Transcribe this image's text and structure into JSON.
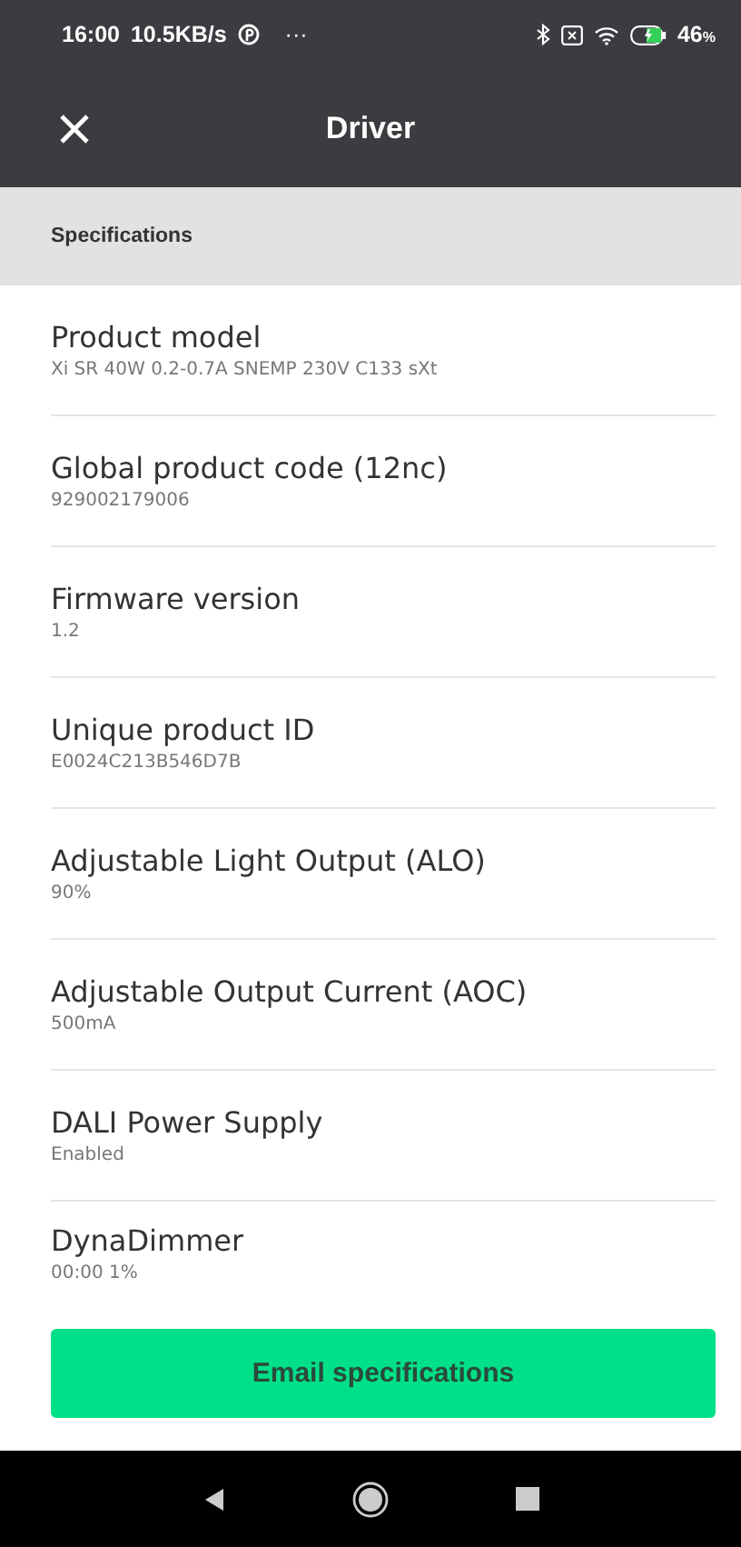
{
  "status_bar": {
    "time": "16:00",
    "speed": "10.5KB/s",
    "more": "···",
    "battery": "46",
    "battery_unit": "%"
  },
  "header": {
    "title": "Driver"
  },
  "section": {
    "title": "Specifications"
  },
  "specs": [
    {
      "label": "Product model",
      "value": "Xi SR 40W 0.2-0.7A SNEMP 230V C133 sXt"
    },
    {
      "label": "Global product code (12nc)",
      "value": "929002179006"
    },
    {
      "label": "Firmware version",
      "value": "1.2"
    },
    {
      "label": "Unique product ID",
      "value": "E0024C213B546D7B"
    },
    {
      "label": "Adjustable Light Output (ALO)",
      "value": "90%"
    },
    {
      "label": "Adjustable Output Current (AOC)",
      "value": "500mA"
    },
    {
      "label": "DALI Power Supply",
      "value": "Enabled"
    },
    {
      "label": "DynaDimmer",
      "value": "00:00 1%"
    }
  ],
  "button": {
    "label": "Email specifications"
  }
}
